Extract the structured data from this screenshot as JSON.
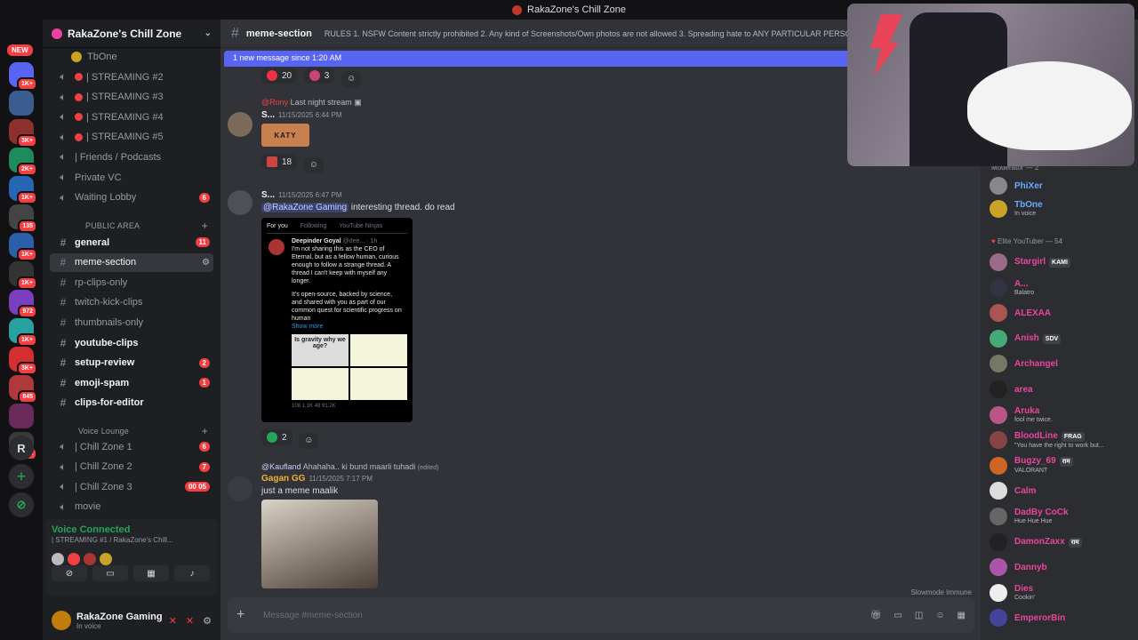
{
  "window": {
    "title": "RakaZone's Chill Zone"
  },
  "rail": {
    "new_label": "NEW",
    "servers": [
      {
        "badge": "1K+",
        "color": "#5865f2"
      },
      {
        "badge": "",
        "color": "#3b5c8f"
      },
      {
        "badge": "3K+",
        "color": "#8b2f2f"
      },
      {
        "badge": "2K+",
        "color": "#1f8a5a"
      },
      {
        "badge": "1K+",
        "color": "#2766b5"
      },
      {
        "badge": "135",
        "color": "#444"
      },
      {
        "badge": "1K+",
        "color": "#2c5fa8"
      },
      {
        "badge": "1K+",
        "color": "#333"
      },
      {
        "badge": "972",
        "color": "#7a3fbf"
      },
      {
        "badge": "1K+",
        "color": "#2aa1a1"
      },
      {
        "badge": "3K+",
        "color": "#d23030"
      },
      {
        "badge": "845",
        "color": "#b03a3a"
      },
      {
        "badge": "",
        "color": "#6a2b5a"
      },
      {
        "badge": "515",
        "color": "#3a3a3a"
      }
    ],
    "r_label": "R",
    "add_glyph": "+",
    "explore_glyph": "⊘"
  },
  "sidebar": {
    "server_name": "RakaZone's Chill Zone",
    "top_user": "TbOne",
    "channels_top": [
      {
        "label": "| STREAMING #2",
        "type": "stream"
      },
      {
        "label": "| STREAMING #3",
        "type": "stream"
      },
      {
        "label": "| STREAMING #4",
        "type": "stream"
      },
      {
        "label": "| STREAMING #5",
        "type": "stream"
      },
      {
        "label": "| Friends / Podcasts",
        "type": "voice"
      },
      {
        "label": "Private VC",
        "type": "voice"
      },
      {
        "label": "Waiting Lobby",
        "type": "voice",
        "count": "6"
      }
    ],
    "public_area": "PUBLIC AREA",
    "text_channels": [
      {
        "label": "general",
        "bold": true,
        "count": "11"
      },
      {
        "label": "meme-section",
        "selected": true
      },
      {
        "label": "rp-clips-only"
      },
      {
        "label": "twitch-kick-clips"
      },
      {
        "label": "thumbnails-only"
      },
      {
        "label": "youtube-clips",
        "bold": true
      },
      {
        "label": "setup-review",
        "bold": true,
        "count": "2"
      },
      {
        "label": "emoji-spam",
        "bold": true,
        "count": "1"
      },
      {
        "label": "clips-for-editor",
        "bold": true
      }
    ],
    "voice_lounge": "Voice Lounge",
    "voice_channels": [
      {
        "label": "| Chill Zone 1",
        "count": "6"
      },
      {
        "label": "| Chill Zone 2",
        "count": "7"
      },
      {
        "label": "| Chill Zone 3",
        "count": "00  05"
      },
      {
        "label": "movie"
      }
    ],
    "voice_connected": {
      "title": "Voice Connected",
      "sub": "| STREAMING #1 / RakaZone's Chill..."
    },
    "user": {
      "name": "RakaZone Gaming",
      "status": "In voice"
    }
  },
  "main": {
    "channel": "meme-section",
    "topic": "RULES 1. NSFW Content strictly prohibited 2. Any kind of Screenshots/Own photos are not allowed 3. Spreading hate to ANY PARTICULAR PERSON",
    "banner": "1 new message since 1:20 AM",
    "top_reactions": [
      {
        "count": "20"
      },
      {
        "count": "3"
      }
    ],
    "messages": [
      {
        "reply_user": "@Rony",
        "reply_text": "Last night stream",
        "author": "S...",
        "time": "11/15/2025 6:44 PM",
        "attachment": "KATY",
        "reaction": "18"
      },
      {
        "author": "S...",
        "time": "11/15/2025 6:47 PM",
        "mention": "@RakaZone Gaming",
        "text": "interesting thread. do read",
        "embed": {
          "tabs": [
            "For you",
            "Following",
            "YouTube Ninjas"
          ],
          "author": "Deepinder Goyal",
          "handle": "@dee... · 1h",
          "para1": "I'm not sharing this as the CEO of Eternal, but as a fellow human, curious enough to follow a strange thread. A thread I can't keep with myself any longer.",
          "para2": "It's open-source, backed by science, and shared with you as part of our common quest for scientific progress on human",
          "show_more": "Show more",
          "img_title": "Is gravity why we age?",
          "stats": "108   1.1K   48   91.2K"
        },
        "reaction": "2"
      },
      {
        "reply_user": "@Kaufland",
        "reply_text": "Ahahaha.. ki bund maarli tuhadi",
        "reply_edited": "(edited)",
        "author": "Gagan GG",
        "time": "11/15/2025 7:17 PM",
        "text": "just a meme maalik"
      }
    ],
    "slowmode": "Slowmode Immune",
    "compose_placeholder": "Message #meme-section"
  },
  "members": {
    "moderator_header": "Moderator — 2",
    "moderators": [
      {
        "name": "PhiXer",
        "color": "#6ea8ff",
        "avatar": "#888"
      },
      {
        "name": "TbOne",
        "status": "In voice",
        "color": "#6ea8ff",
        "avatar": "#c9a227"
      }
    ],
    "elite_header": "Elite YouTuber — 54",
    "elite": [
      {
        "name": "Stargirl",
        "tag": "KAMI",
        "color": "#eb459e",
        "avatar": "#9a6a8a"
      },
      {
        "name": "A...",
        "status": "Balatro",
        "color": "#eb459e",
        "avatar": "#334"
      },
      {
        "name": "ALEXAA",
        "color": "#eb459e",
        "avatar": "#a55"
      },
      {
        "name": "Anish",
        "tag": "SDV",
        "color": "#eb459e",
        "avatar": "#4a7"
      },
      {
        "name": "Archangel",
        "color": "#eb459e",
        "avatar": "#776"
      },
      {
        "name": "area",
        "color": "#eb459e",
        "avatar": "#222"
      },
      {
        "name": "Aruka",
        "status": "fool me twice.",
        "color": "#eb459e",
        "avatar": "#b58"
      },
      {
        "name": "BloodLine",
        "tag": "FRAG",
        "status": "\"You have the right to work but...",
        "color": "#eb459e",
        "avatar": "#844"
      },
      {
        "name": "Bugzy_69",
        "tag": "राम",
        "status": "VALORANT",
        "color": "#eb459e",
        "avatar": "#c62"
      },
      {
        "name": "Calm",
        "color": "#eb459e",
        "avatar": "#ddd"
      },
      {
        "name": "DadBy CoCk",
        "status": "Hue Hue Hue",
        "color": "#eb459e",
        "avatar": "#666"
      },
      {
        "name": "DamonZaxx",
        "tag": "राम",
        "color": "#eb459e",
        "avatar": "#222"
      },
      {
        "name": "Dannyb",
        "color": "#eb459e",
        "avatar": "#a5a"
      },
      {
        "name": "Dies",
        "status": "Cookin'",
        "color": "#eb459e",
        "avatar": "#eee"
      },
      {
        "name": "EmperorBin",
        "color": "#eb459e",
        "avatar": "#449"
      }
    ]
  },
  "colors": {
    "accent": "#5865f2",
    "online": "#23a55a",
    "alert": "#f23f43",
    "elite": "#eb459e",
    "mod": "#6ea8ff"
  }
}
